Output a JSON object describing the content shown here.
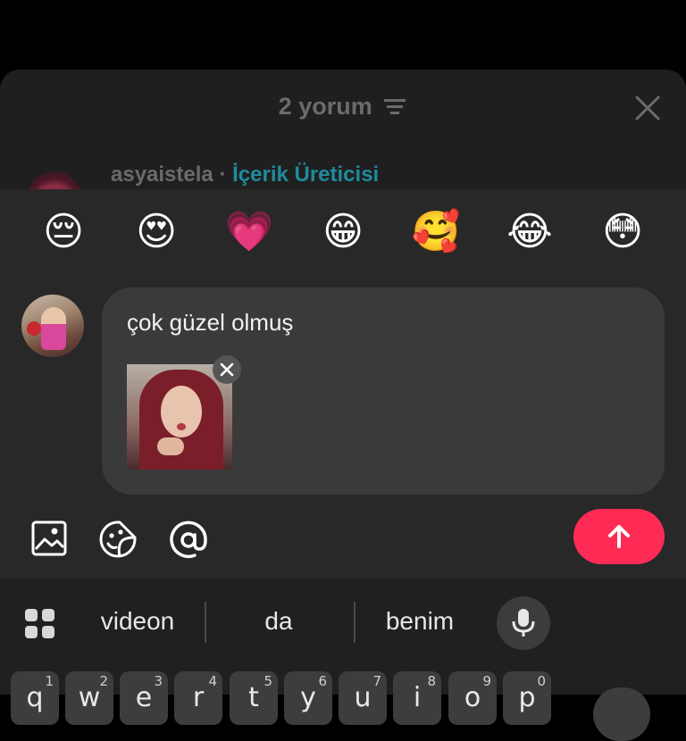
{
  "header": {
    "comment_count": "2 yorum",
    "filter_icon": "filter-lines-icon",
    "close_icon": "close-icon"
  },
  "comment_preview": {
    "username": "asyaistela",
    "separator": "·",
    "badge": "İçerik Üreticisi"
  },
  "emoji_bar": {
    "emojis": [
      "😔",
      "😍",
      "💗",
      "😁",
      "🥰",
      "😂",
      "😳"
    ]
  },
  "composer": {
    "text": "çok güzel olmuş",
    "attachment": "gif",
    "remove_icon": "close-icon"
  },
  "toolbar": {
    "icons": [
      "image-icon",
      "sticker-icon",
      "mention-icon"
    ],
    "send_icon": "arrow-up-icon",
    "send_color": "#ff2b55"
  },
  "keyboard": {
    "suggestions": [
      "videon",
      "da",
      "benim"
    ],
    "mic_icon": "mic-icon",
    "keys": [
      {
        "letter": "q",
        "num": "1"
      },
      {
        "letter": "w",
        "num": "2"
      },
      {
        "letter": "e",
        "num": "3"
      },
      {
        "letter": "r",
        "num": "4"
      },
      {
        "letter": "t",
        "num": "5"
      },
      {
        "letter": "y",
        "num": "6"
      },
      {
        "letter": "u",
        "num": "7"
      },
      {
        "letter": "i",
        "num": "8"
      },
      {
        "letter": "o",
        "num": "9"
      },
      {
        "letter": "p",
        "num": "0"
      }
    ]
  }
}
